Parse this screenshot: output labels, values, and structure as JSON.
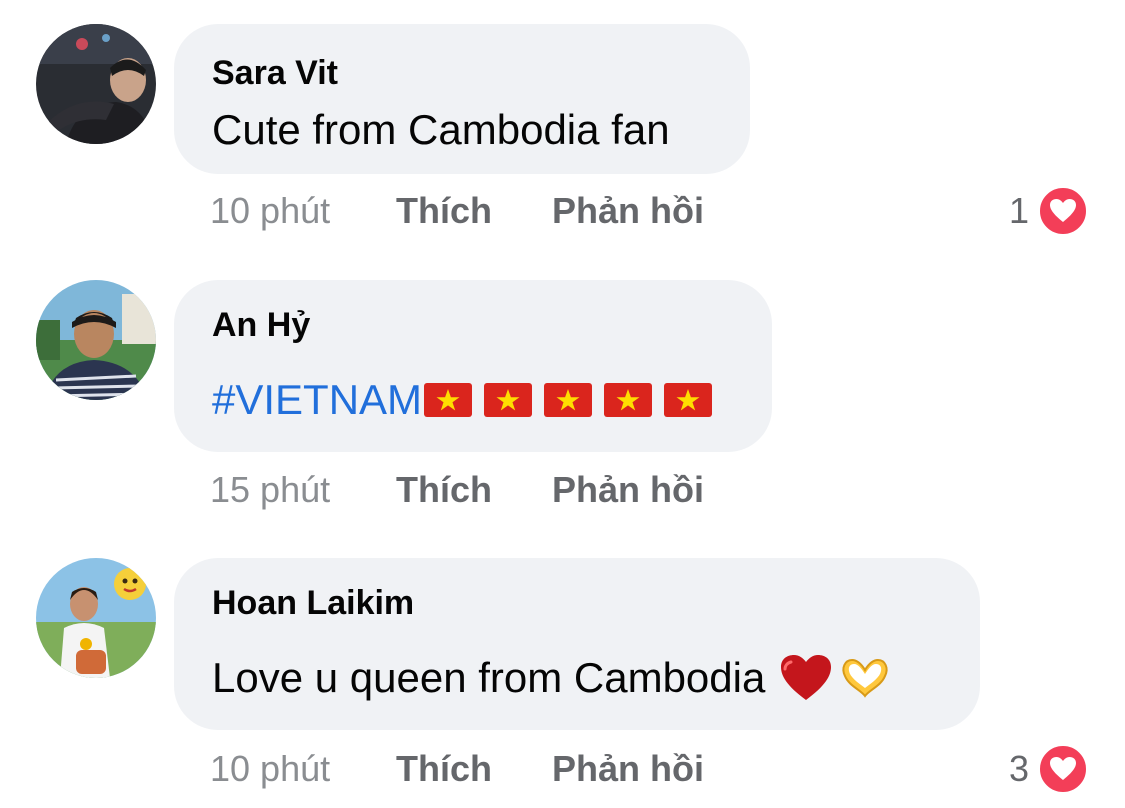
{
  "comments": [
    {
      "author": "Sara Vit",
      "text": "Cute from Cambodia fan",
      "time": "10 phút",
      "like_label": "Thích",
      "reply_label": "Phản hồi",
      "reaction_count": "1",
      "reaction_icon": "heart-icon"
    },
    {
      "author": "An Hỷ",
      "text": "#VIETNAM",
      "emojis": [
        "vietnam-flag",
        "vietnam-flag",
        "vietnam-flag",
        "vietnam-flag",
        "vietnam-flag"
      ],
      "time": "15 phút",
      "like_label": "Thích",
      "reply_label": "Phản hồi"
    },
    {
      "author": "Hoan Laikim",
      "text": "Love u queen from Cambodia",
      "emojis": [
        "red-heart",
        "heart-hands"
      ],
      "time": "10 phút",
      "like_label": "Thích",
      "reply_label": "Phản hồi",
      "reaction_count": "3",
      "reaction_icon": "heart-icon"
    }
  ],
  "colors": {
    "bubble": "#f0f2f5",
    "hashtag": "#216fdb",
    "reaction_heart": "#f33e58",
    "meta_text": "#65676b"
  }
}
